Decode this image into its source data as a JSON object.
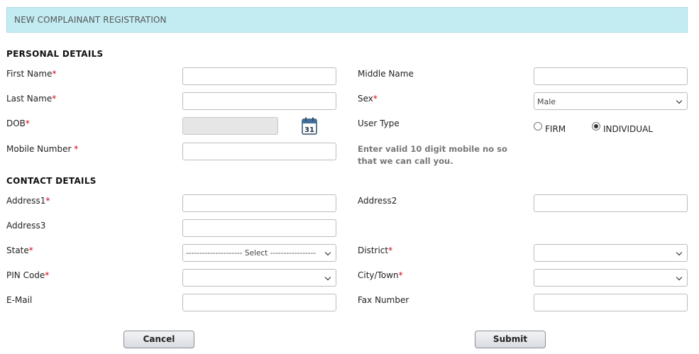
{
  "header": {
    "title": "NEW COMPLAINANT REGISTRATION"
  },
  "sections": {
    "personal": "PERSONAL DETAILS",
    "contact": "CONTACT DETAILS"
  },
  "labels": {
    "first_name": "First Name",
    "middle_name": "Middle Name",
    "last_name": "Last Name",
    "sex": "Sex",
    "dob": "DOB",
    "user_type": "User Type",
    "mobile": "Mobile Number ",
    "address1": "Address1",
    "address2": "Address2",
    "address3": "Address3",
    "state": "State",
    "district": "District",
    "pin": "PIN Code",
    "city": "City/Town",
    "email": "E-Mail",
    "fax": "Fax Number"
  },
  "required_mark": "*",
  "sex_select": {
    "value": "Male"
  },
  "state_select": {
    "value": "--------------------- Select -----------------"
  },
  "calendar_icon": {
    "icon": "calendar-icon",
    "day": "31"
  },
  "user_type": {
    "options": [
      {
        "label": "FIRM",
        "selected": false
      },
      {
        "label": "INDIVIDUAL",
        "selected": true
      }
    ]
  },
  "mobile_hint": "Enter valid 10 digit mobile no so that we can call you.",
  "buttons": {
    "cancel": "Cancel",
    "submit": "Submit"
  }
}
